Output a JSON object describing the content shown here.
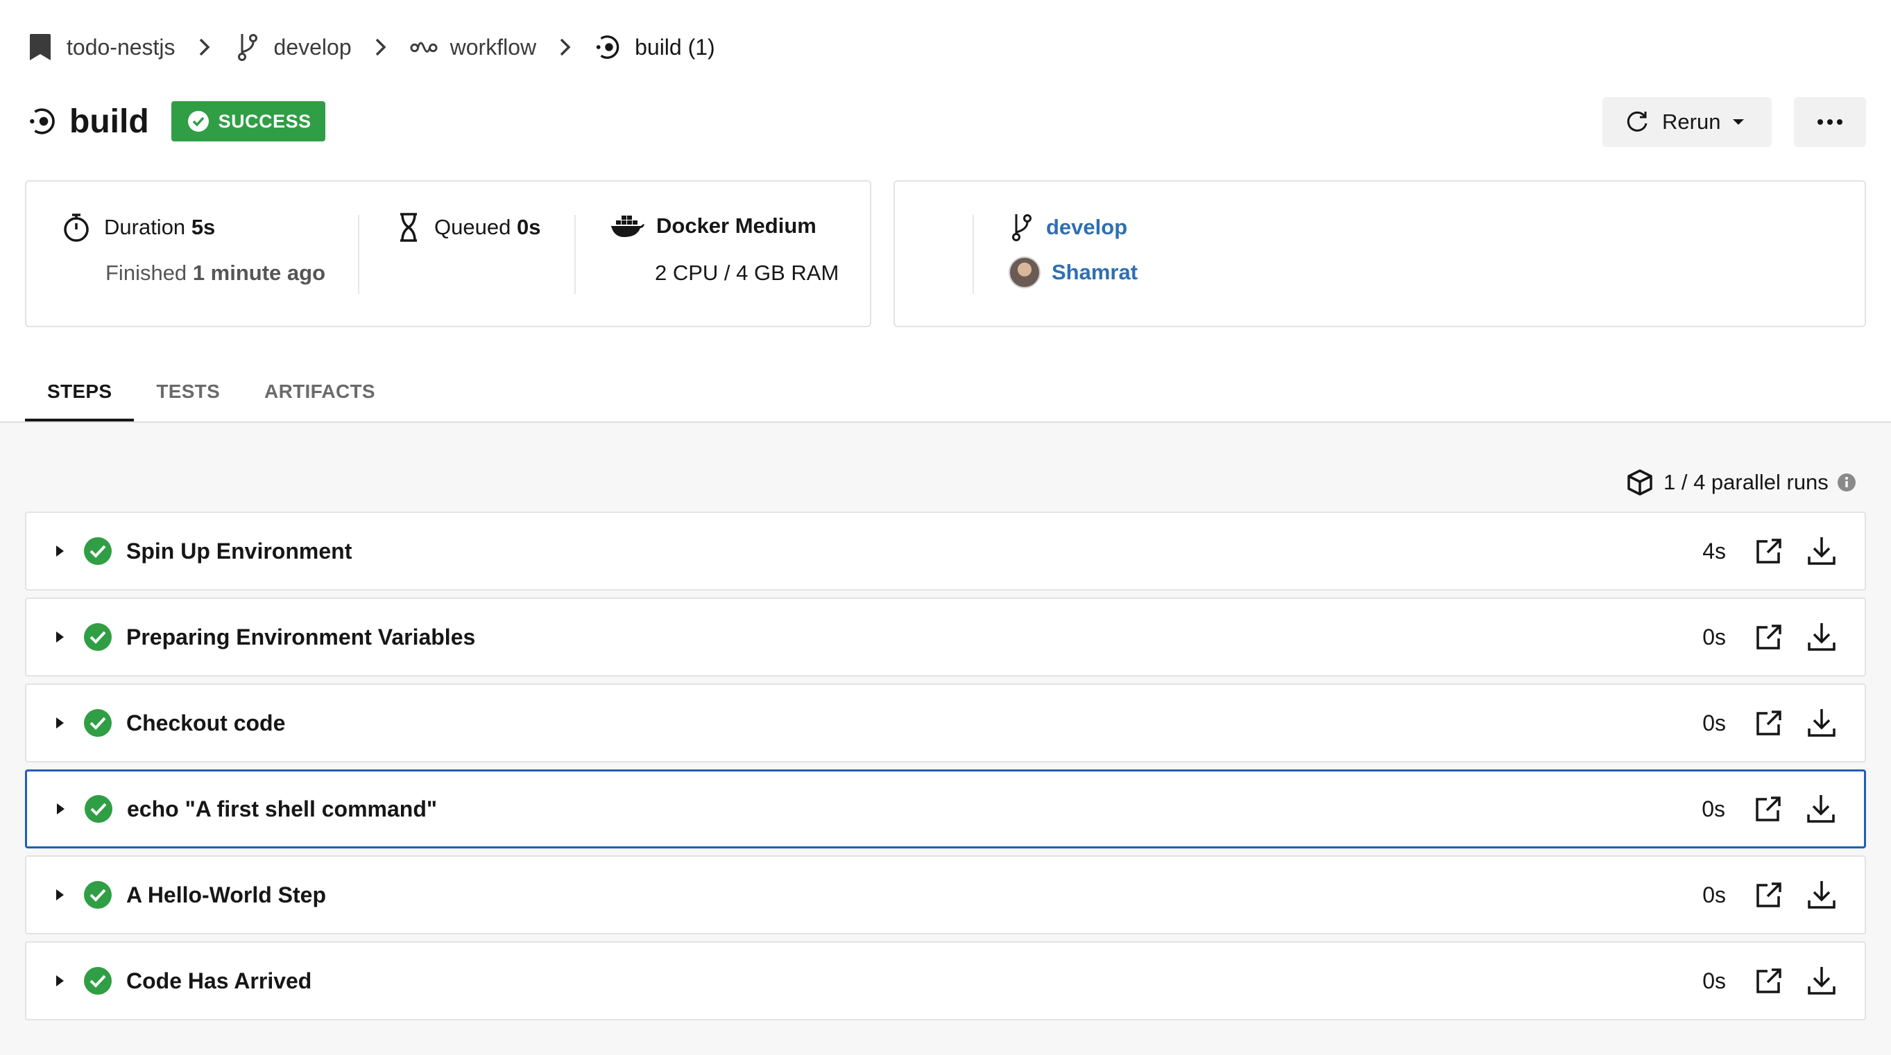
{
  "breadcrumb": {
    "project": "todo-nestjs",
    "branch": "develop",
    "workflow": "workflow",
    "job": "build (1)"
  },
  "header": {
    "title": "build",
    "status": "SUCCESS",
    "rerun_label": "Rerun"
  },
  "info": {
    "duration_label": "Duration",
    "duration_value": "5s",
    "finished_label": "Finished",
    "finished_value": "1 minute ago",
    "queued_label": "Queued",
    "queued_value": "0s",
    "executor": "Docker Medium",
    "resources": "2 CPU / 4 GB RAM",
    "branch": "develop",
    "user": "Shamrat"
  },
  "tabs": [
    {
      "label": "STEPS",
      "active": true
    },
    {
      "label": "TESTS",
      "active": false
    },
    {
      "label": "ARTIFACTS",
      "active": false
    }
  ],
  "parallel": "1 / 4 parallel runs",
  "steps": [
    {
      "name": "Spin Up Environment",
      "duration": "4s",
      "selected": false
    },
    {
      "name": "Preparing Environment Variables",
      "duration": "0s",
      "selected": false
    },
    {
      "name": "Checkout code",
      "duration": "0s",
      "selected": false
    },
    {
      "name": "echo \"A first shell command\"",
      "duration": "0s",
      "selected": true
    },
    {
      "name": "A Hello-World Step",
      "duration": "0s",
      "selected": false
    },
    {
      "name": "Code Has Arrived",
      "duration": "0s",
      "selected": false
    }
  ],
  "colors": {
    "success": "#2f9e44",
    "link": "#2f6fb0",
    "selected_border": "#1f5fb8"
  }
}
